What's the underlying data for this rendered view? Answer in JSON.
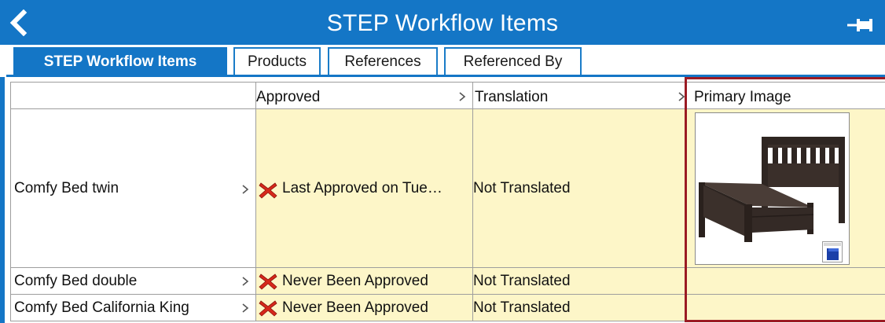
{
  "window": {
    "title": "STEP Workflow Items",
    "icons": {
      "back": "chevron-left-icon",
      "pin": "pin-icon"
    }
  },
  "tabs": [
    {
      "label": "STEP Workflow Items",
      "active": true
    },
    {
      "label": "Products",
      "active": false
    },
    {
      "label": "References",
      "active": false
    },
    {
      "label": "Referenced By",
      "active": false
    }
  ],
  "table": {
    "columns": [
      "",
      "Approved",
      "Translation",
      "Primary Image"
    ],
    "rows": [
      {
        "name": "Comfy Bed twin",
        "approved": "Last Approved on Tue…",
        "translation": "Not Translated",
        "has_image": true
      },
      {
        "name": "Comfy Bed double",
        "approved": "Never Been Approved",
        "translation": "Not Translated",
        "has_image": false
      },
      {
        "name": "Comfy Bed California King",
        "approved": "Never Been Approved",
        "translation": "Not Translated",
        "has_image": false
      }
    ]
  },
  "colors": {
    "accent": "#1476c6",
    "row_bg": "#fdf6c8",
    "status_error": "#d6281b",
    "highlight": "#9b1b24"
  }
}
